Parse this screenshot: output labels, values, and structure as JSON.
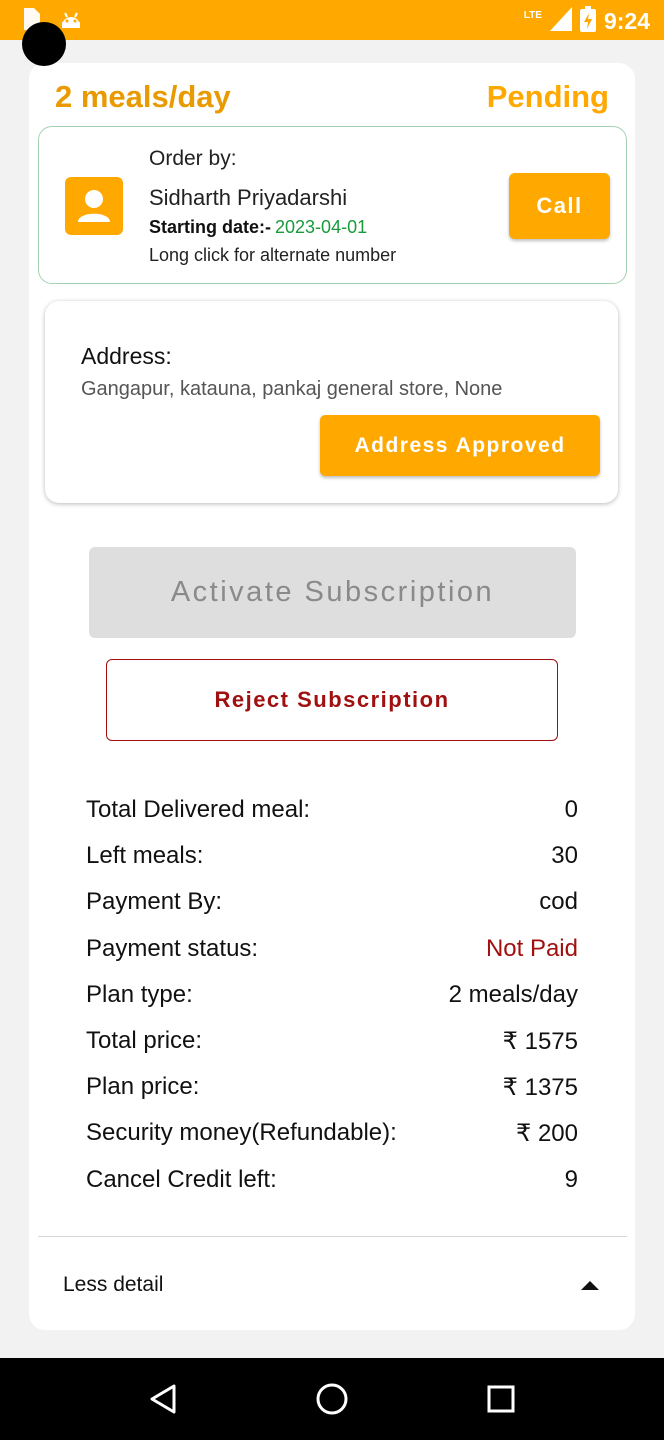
{
  "status_bar": {
    "time": "9:24",
    "network": "LTE"
  },
  "header": {
    "plan": "2 meals/day",
    "status": "Pending"
  },
  "order": {
    "order_by_label": "Order by:",
    "customer_name": "Sidharth Priyadarshi",
    "starting_label": "Starting date:-",
    "starting_date": "2023-04-01",
    "hint": "Long click for alternate number",
    "call_label": "Call"
  },
  "address": {
    "label": "Address:",
    "value": "Gangapur, katauna, pankaj general store, None",
    "approved_label": "Address Approved"
  },
  "actions": {
    "activate_label": "Activate Subscription",
    "reject_label": "Reject Subscription"
  },
  "details": [
    {
      "label": "Total Delivered meal:",
      "value": "0"
    },
    {
      "label": "Left meals:",
      "value": "30"
    },
    {
      "label": "Payment By:",
      "value": "cod"
    },
    {
      "label": "Payment status:",
      "value": "Not Paid"
    },
    {
      "label": "Plan type:",
      "value": "2 meals/day"
    },
    {
      "label": "Total price:",
      "value": "₹ 1575"
    },
    {
      "label": "Plan price:",
      "value": "₹ 1375"
    },
    {
      "label": "Security money(Refundable):",
      "value": "₹ 200"
    },
    {
      "label": "Cancel Credit left:",
      "value": "9"
    }
  ],
  "footer": {
    "less_label": "Less detail"
  },
  "colors": {
    "accent": "#FFA800",
    "reject": "#a01010",
    "date_green": "#1a9a3a"
  }
}
